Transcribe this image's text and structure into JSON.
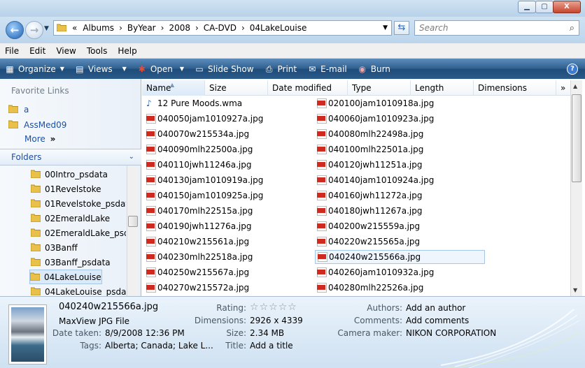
{
  "window": {
    "min_icon": "minimize-glyph",
    "max_icon": "maximize-glyph",
    "close_glyph": "X"
  },
  "address": {
    "chevron": "«",
    "crumbs": [
      "Albums",
      "ByYear",
      "2008",
      "CA-DVD",
      "04LakeLouise"
    ],
    "separator": "›"
  },
  "search": {
    "placeholder": "Search"
  },
  "menu": [
    "File",
    "Edit",
    "View",
    "Tools",
    "Help"
  ],
  "toolbar": {
    "organize": "Organize",
    "views": "Views",
    "open": "Open",
    "slideshow": "Slide Show",
    "print": "Print",
    "email": "E-mail",
    "burn": "Burn"
  },
  "nav": {
    "favorites_header": "Favorite Links",
    "favorites": [
      "a",
      "AssMed09"
    ],
    "more": "More",
    "more_glyph": "»",
    "folders_header": "Folders",
    "tree": [
      "00Intro_psdata",
      "01Revelstoke",
      "01Revelstoke_psdat",
      "02EmeraldLake",
      "02EmeraldLake_psd",
      "03Banff",
      "03Banff_psdata",
      "04LakeLouise",
      "04LakeLouise_psdat"
    ],
    "selected_index": 7
  },
  "columns": {
    "name": "Name",
    "size": "Size",
    "date": "Date modified",
    "type": "Type",
    "length": "Length",
    "dimensions": "Dimensions",
    "more": "»"
  },
  "files": [
    [
      "12 Pure Moods.wma",
      "020100jam1010918a.jpg"
    ],
    [
      "040050jam1010927a.jpg",
      "040060jam1010923a.jpg"
    ],
    [
      "040070w215534a.jpg",
      "040080mlh22498a.jpg"
    ],
    [
      "040090mlh22500a.jpg",
      "040100mlh22501a.jpg"
    ],
    [
      "040110jwh11246a.jpg",
      "040120jwh11251a.jpg"
    ],
    [
      "040130jam1010919a.jpg",
      "040140jam1010924a.jpg"
    ],
    [
      "040150jam1010925a.jpg",
      "040160jwh11272a.jpg"
    ],
    [
      "040170mlh22515a.jpg",
      "040180jwh11267a.jpg"
    ],
    [
      "040190jwh11276a.jpg",
      "040200w215559a.jpg"
    ],
    [
      "040210w215561a.jpg",
      "040220w215565a.jpg"
    ],
    [
      "040230mlh22518a.jpg",
      "040240w215566a.jpg"
    ],
    [
      "040250w215567a.jpg",
      "040260jam1010932a.jpg"
    ],
    [
      "040270w215572a.jpg",
      "040280mlh22526a.jpg"
    ]
  ],
  "selected_file": "040240w215566a.jpg",
  "details": {
    "filename": "040240w215566a.jpg",
    "filetype": "MaxView JPG File",
    "date_taken_label": "Date taken:",
    "date_taken": "8/9/2008 12:36 PM",
    "tags_label": "Tags:",
    "tags": "Alberta; Canada; Lake L...",
    "rating_label": "Rating:",
    "rating_stars": 0,
    "dimensions_label": "Dimensions:",
    "dimensions": "2926 x 4339",
    "size_label": "Size:",
    "size": "2.34 MB",
    "title_label": "Title:",
    "title": "Add a title",
    "authors_label": "Authors:",
    "authors": "Add an author",
    "comments_label": "Comments:",
    "comments": "Add comments",
    "camera_label": "Camera maker:",
    "camera": "NIKON CORPORATION"
  }
}
